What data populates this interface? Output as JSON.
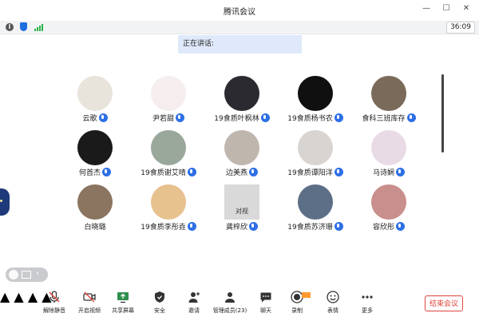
{
  "window": {
    "title": "腾讯会议",
    "controls": [
      "—",
      "☐",
      "✕"
    ]
  },
  "infobar": {
    "timer": "36:09"
  },
  "speaking": {
    "label": "正在讲话:"
  },
  "participants": [
    {
      "name": "云歌",
      "mic": true,
      "bg": "#e8e4dc"
    },
    {
      "name": "尹若甜",
      "mic": true,
      "bg": "#f6eeee"
    },
    {
      "name": "19食质叶枫林",
      "mic": true,
      "bg": "#2a2a30"
    },
    {
      "name": "19食质杨书农",
      "mic": true,
      "bg": "#101010"
    },
    {
      "name": "食科三班库存",
      "mic": true,
      "bg": "#7a6a5a"
    },
    {
      "name": "何首杰",
      "mic": true,
      "bg": "#1a1a1a"
    },
    {
      "name": "19食质谢艾晴",
      "mic": true,
      "bg": "#9aa79b"
    },
    {
      "name": "边美燕",
      "mic": true,
      "bg": "#bfb6ae"
    },
    {
      "name": "19食质谭阳洋",
      "mic": true,
      "bg": "#d8d4d2"
    },
    {
      "name": "马诗娴",
      "mic": true,
      "bg": "#e9dbe6"
    },
    {
      "name": "白晓璐",
      "mic": false,
      "bg": "#8b7560"
    },
    {
      "name": "19食质李彤垚",
      "mic": true,
      "bg": "#e7c28f"
    },
    {
      "name": "龚梓欣",
      "mic": true,
      "bg": "#d9d9d9",
      "caption": "对视"
    },
    {
      "name": "19食质苏济珊",
      "mic": true,
      "bg": "#5d6f86"
    },
    {
      "name": "容欣彤",
      "mic": true,
      "bg": "#c98f8c"
    }
  ],
  "toolbar": {
    "mute": "解除静音",
    "video": "开启视频",
    "share": "共享屏幕",
    "security": "安全",
    "invite": "邀请",
    "members": "管理成员(23)",
    "chat": "聊天",
    "record": "录制",
    "reactions": "表情",
    "more": "更多",
    "end": "结束会议"
  },
  "colors": {
    "accent": "#2d6fe6",
    "danger": "#e0453b",
    "signal": "#2cb34a"
  }
}
